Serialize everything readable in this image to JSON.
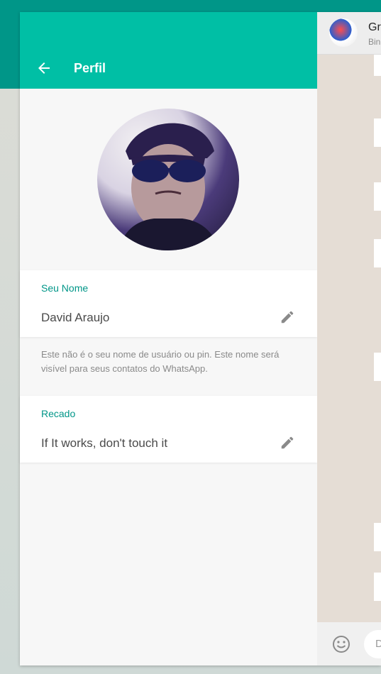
{
  "profile": {
    "title": "Perfil",
    "name_label": "Seu Nome",
    "name_value": "David Araujo",
    "name_hint": "Este não é o seu nome de usuário ou pin. Este nome será visível para seus contatos do WhatsApp.",
    "about_label": "Recado",
    "about_value": "If It works, don't touch it"
  },
  "chat": {
    "contact_name": "Gri",
    "contact_sub": "Bin",
    "compose_placeholder": "D"
  },
  "colors": {
    "header": "#00bfa5",
    "band": "#009688",
    "accent_label": "#009688",
    "chat_bg": "#e5ddd5"
  },
  "icons": [
    "arrow-back-icon",
    "pencil-icon",
    "emoji-icon"
  ]
}
